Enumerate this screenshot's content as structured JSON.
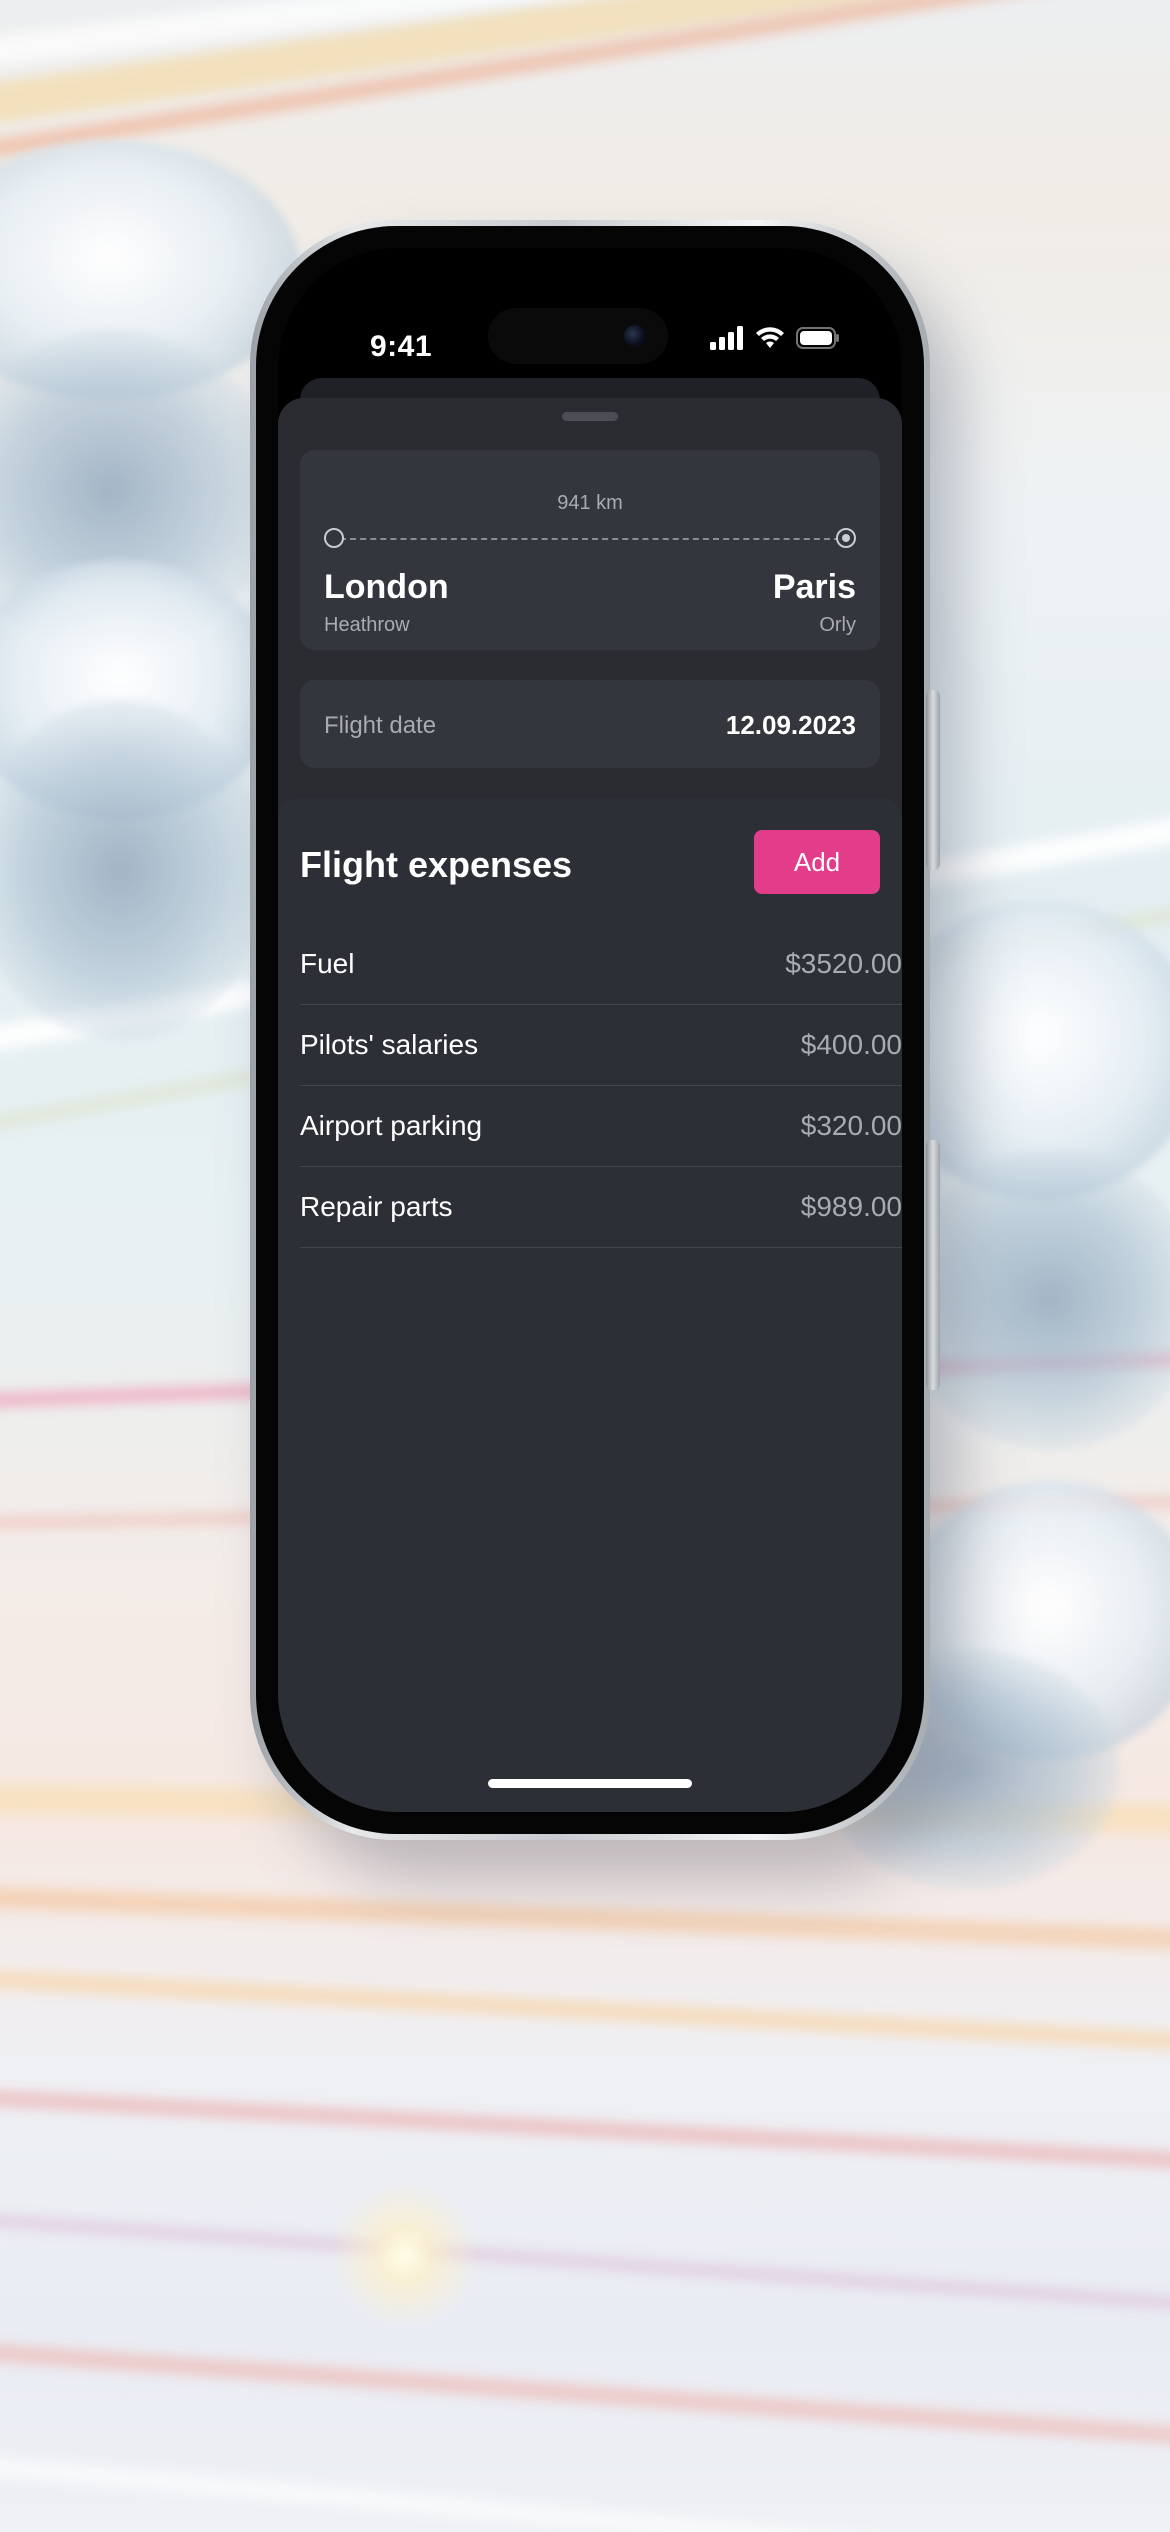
{
  "status_bar": {
    "time": "9:41",
    "icons": [
      "cellular-signal-icon",
      "wifi-icon",
      "battery-icon"
    ]
  },
  "route": {
    "distance": "941 km",
    "from": {
      "city": "London",
      "airport": "Heathrow"
    },
    "to": {
      "city": "Paris",
      "airport": "Orly"
    }
  },
  "flight_date": {
    "label": "Flight date",
    "value": "12.09.2023"
  },
  "expenses": {
    "title": "Flight expenses",
    "add_label": "Add",
    "items": [
      {
        "name": "Fuel",
        "amount": "$3520.00"
      },
      {
        "name": "Pilots' salaries",
        "amount": "$400.00"
      },
      {
        "name": "Airport parking",
        "amount": "$320.00"
      },
      {
        "name": "Repair parts",
        "amount": "$989.00"
      }
    ]
  },
  "colors": {
    "accent": "#e23c8a",
    "sheet_background": "#2a2c31",
    "card_background": "#33363c",
    "primary_text": "#ffffff",
    "secondary_text": "#a8abb1"
  }
}
